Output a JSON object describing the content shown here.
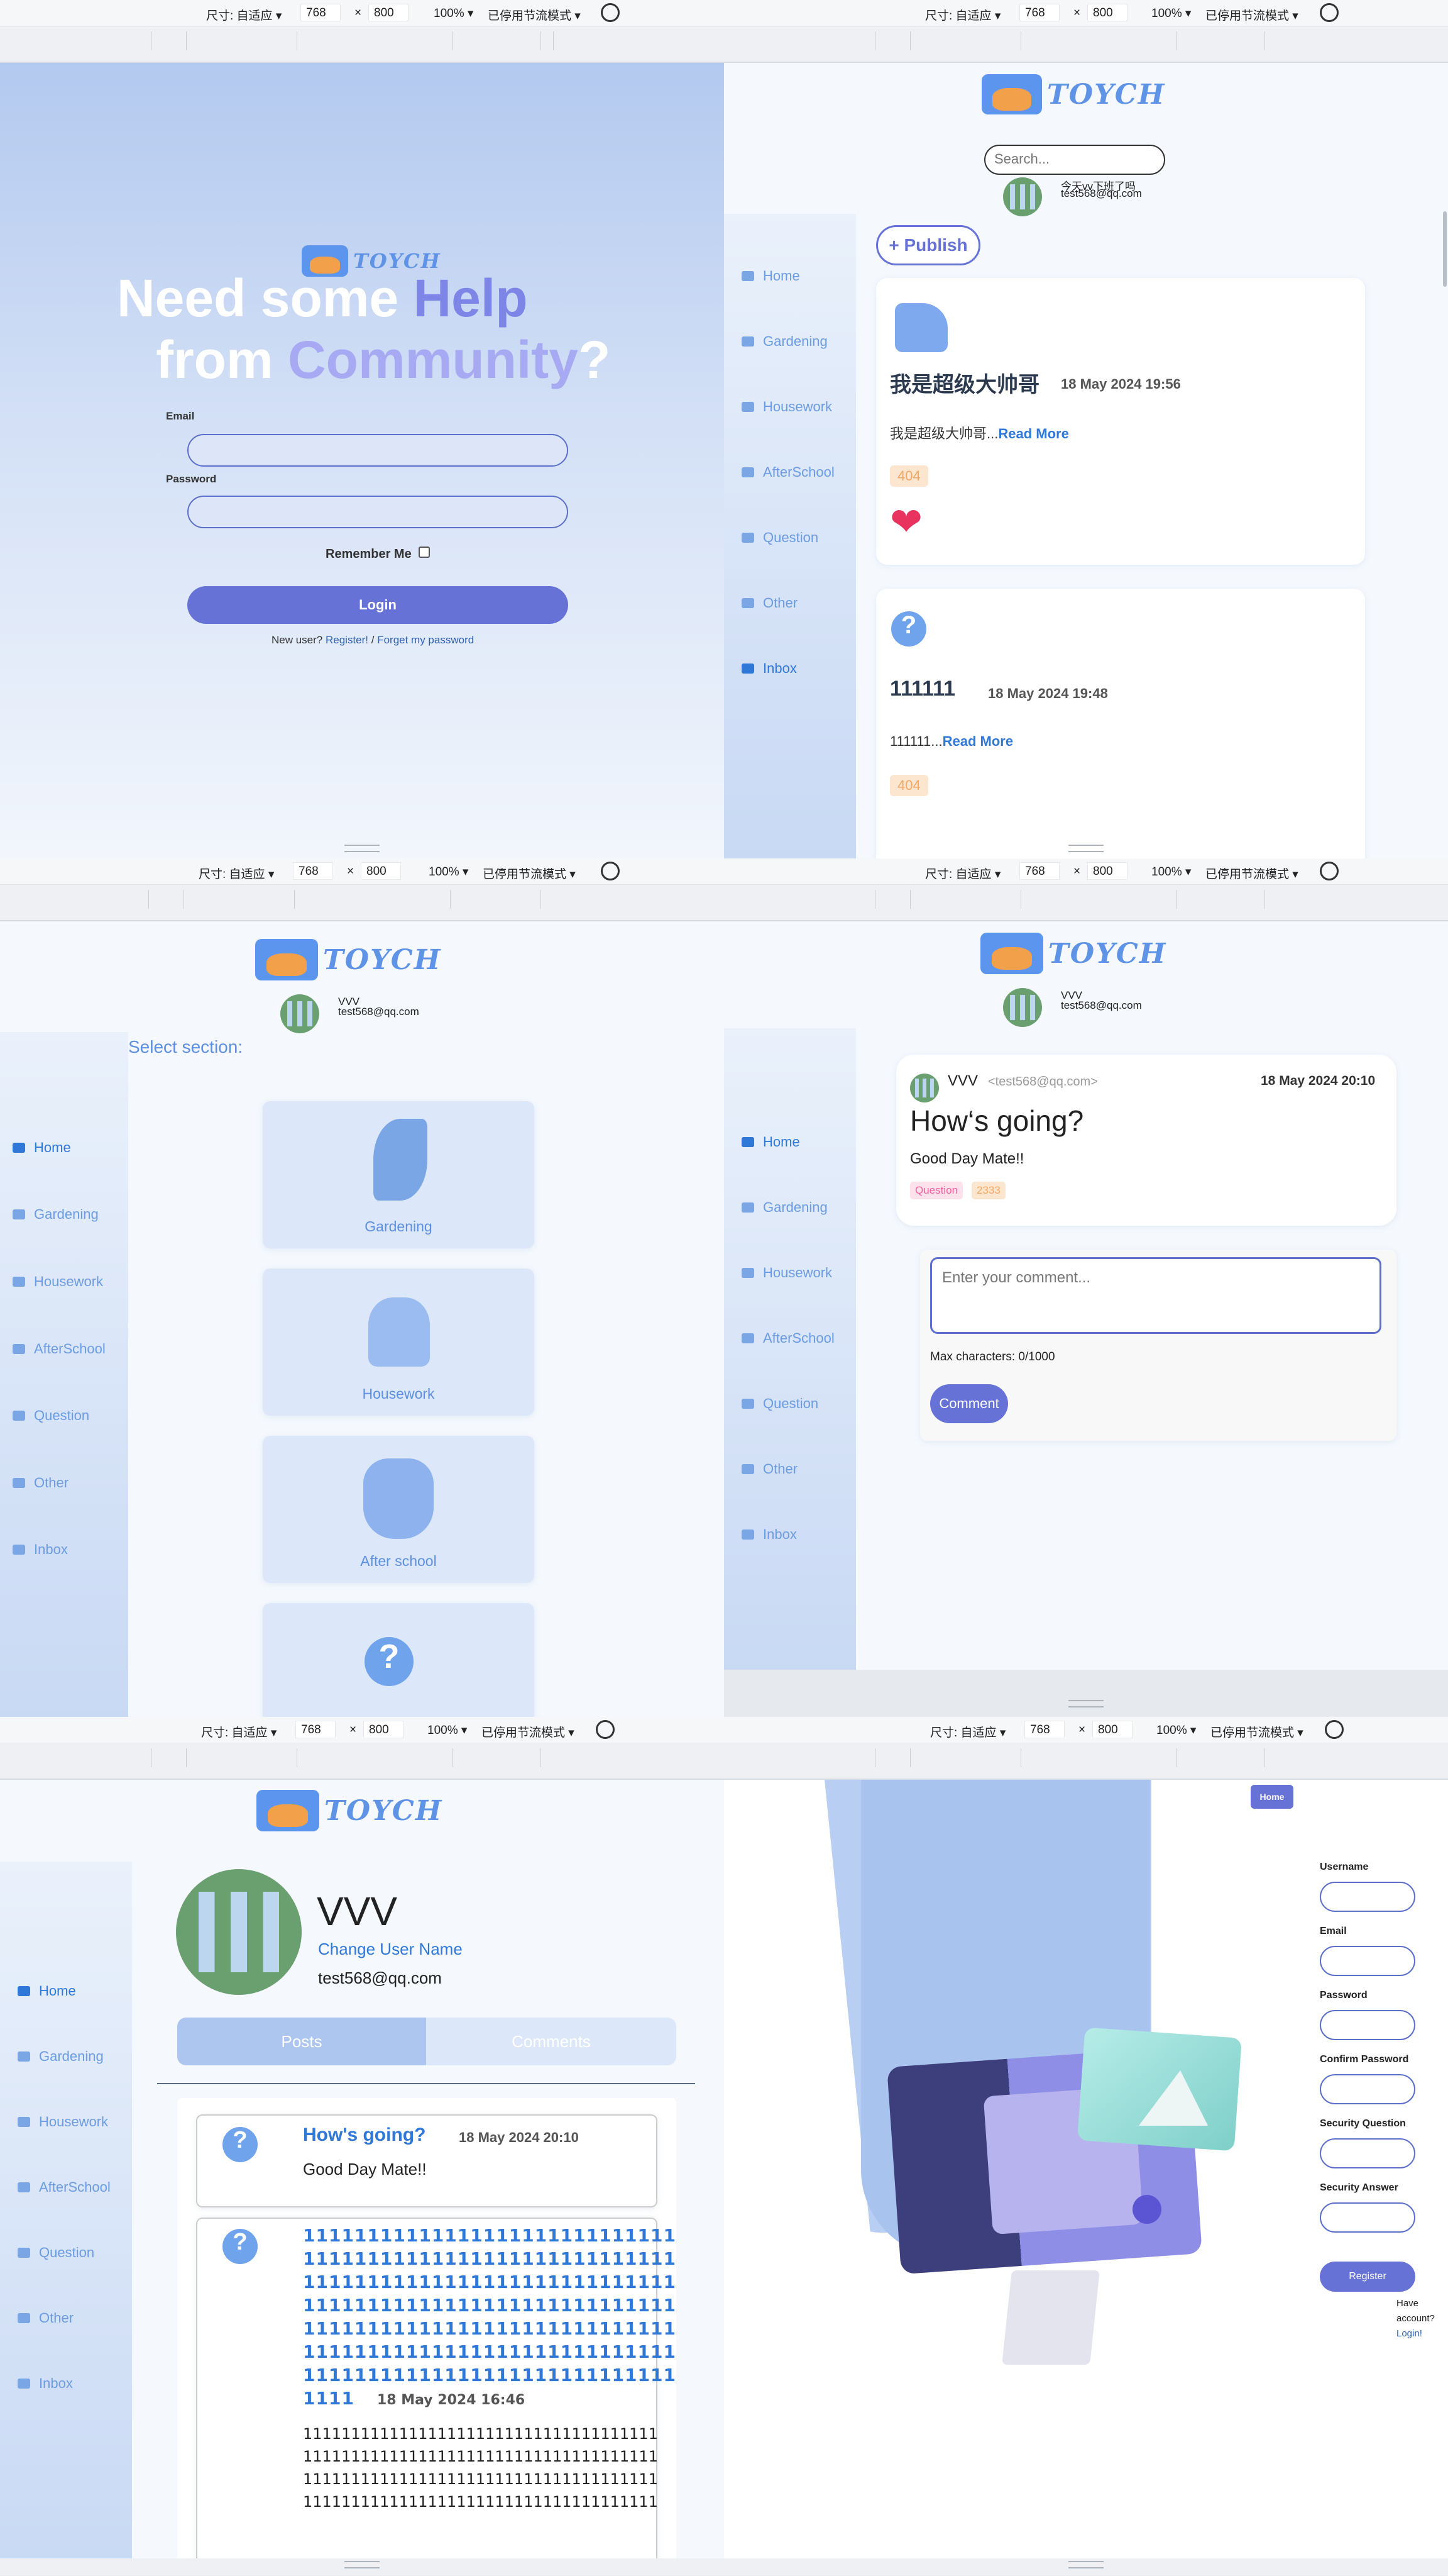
{
  "toolbar": {
    "size_label": "尺寸: 自适应 ▾",
    "width": "768",
    "x": "×",
    "height": "800",
    "zoom": "100% ▾",
    "throttle": "已停用节流模式 ▾"
  },
  "brand": {
    "name": "TOYCH",
    "accent": "#6672d6",
    "link": "#2f78d8"
  },
  "nav": [
    "Home",
    "Gardening",
    "Housework",
    "AfterSchool",
    "Question",
    "Other",
    "Inbox"
  ],
  "login": {
    "headline_1": "Need some ",
    "headline_help": "Help",
    "headline_2": "from ",
    "headline_community": "Community",
    "headline_q": "?",
    "email_label": "Email",
    "password_label": "Password",
    "remember": "Remember Me",
    "login_button": "Login",
    "footer_text": "New user? ",
    "register_link": "Register!",
    "slash": " / ",
    "forget_link": "Forget my password"
  },
  "feed": {
    "search_placeholder": "Search...",
    "user_name": "今天vv下班了吗",
    "user_email": "test568@qq.com",
    "publish": "+ Publish",
    "posts": [
      {
        "title": "我是超级大帅哥",
        "date": "18 May 2024 19:56",
        "excerpt": "我是超级大帅哥...",
        "read_more": "Read More",
        "tag": "404"
      },
      {
        "title": "111111",
        "date": "18 May 2024 19:48",
        "excerpt": "111111...",
        "read_more": "Read More",
        "tag": "404"
      }
    ]
  },
  "section": {
    "user_name": "VVV",
    "user_email": "test568@qq.com",
    "title": "Select section:",
    "cards": [
      "Gardening",
      "Housework",
      "After school",
      ""
    ]
  },
  "post_detail": {
    "user_name": "VVV",
    "user_email": "test568@qq.com",
    "author": "VVV",
    "author_email": "<test568@qq.com>",
    "date": "18 May 2024 20:10",
    "title": "How‘s going?",
    "body": "Good Day Mate!!",
    "tags": [
      "Question",
      "2333"
    ],
    "comment_placeholder": "Enter your comment...",
    "max_chars": "Max characters: 0/1000",
    "comment_button": "Comment"
  },
  "profile": {
    "name": "VVV",
    "change_name": "Change User Name",
    "email": "test568@qq.com",
    "tabs": [
      "Posts",
      "Comments"
    ],
    "posts": [
      {
        "title": "How's going?",
        "date": "18 May 2024 20:10",
        "body": "Good Day Mate!!"
      },
      {
        "title_lines": [
          "11111111111111111111111111111",
          "11111111111111111111111111111",
          "11111111111111111111111111111",
          "11111111111111111111111111111",
          "11111111111111111111111111111",
          "11111111111111111111111111111",
          "11111111111111111111111111111"
        ],
        "title_last": "1111",
        "date": "18 May 2024 16:46",
        "body_lines": [
          "1111111111111111111111111111111111111",
          "1111111111111111111111111111111111111",
          "1111111111111111111111111111111111111",
          "1111111111111111111111111111111111111"
        ]
      }
    ]
  },
  "register": {
    "home": "Home",
    "fields": [
      "Username",
      "Email",
      "Password",
      "Confirm Password",
      "Security Question",
      "Security Answer"
    ],
    "button": "Register",
    "have": "Have",
    "account": "account?",
    "login": "Login!"
  }
}
